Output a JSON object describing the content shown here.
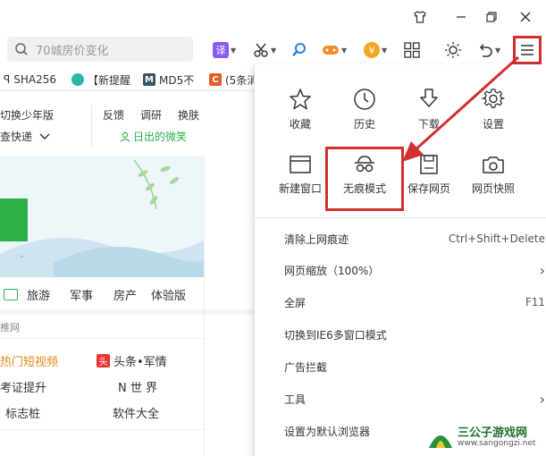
{
  "titlebar": {
    "icons": [
      "tshirt-icon",
      "minimize-icon",
      "restore-icon",
      "close-icon"
    ]
  },
  "search": {
    "placeholder": "70城房价变化"
  },
  "toolbar": {
    "translate_label": "译",
    "fund_label": "¥"
  },
  "bookmarks": [
    {
      "label": "SHA256",
      "color": "#333"
    },
    {
      "label": "【新提醒",
      "color": "#2aa"
    },
    {
      "label": "MD5不",
      "icon_text": "M",
      "color": "#356"
    },
    {
      "label": "(5条消",
      "icon_text": "C",
      "color": "#e55"
    }
  ],
  "page": {
    "row1": [
      "切换少年版",
      "反馈",
      "调研",
      "换肤"
    ],
    "row2_left": "查快递",
    "row2_right": "日出的微笑",
    "nav": [
      "旅游",
      "军事",
      "房产",
      "体验版"
    ],
    "section_label": "推网",
    "links": [
      {
        "left": "热门短视频",
        "right": "头条•军情",
        "right_icon": "头"
      },
      {
        "left": "考证提升",
        "right": "N 世 界"
      },
      {
        "left": "标志桩",
        "right": "软件大全"
      }
    ]
  },
  "menu": {
    "grid_row1": [
      {
        "label": "收藏",
        "icon": "star-icon"
      },
      {
        "label": "历史",
        "icon": "clock-icon"
      },
      {
        "label": "下载",
        "icon": "download-icon"
      },
      {
        "label": "设置",
        "icon": "gear-icon"
      }
    ],
    "grid_row2": [
      {
        "label": "新建窗口",
        "icon": "window-icon"
      },
      {
        "label": "无痕模式",
        "icon": "incognito-icon"
      },
      {
        "label": "保存网页",
        "icon": "save-icon"
      },
      {
        "label": "网页快照",
        "icon": "camera-icon"
      }
    ],
    "items": [
      {
        "label": "清除上网痕迹",
        "shortcut": "Ctrl+Shift+Delete"
      },
      {
        "label": "网页缩放（100%）",
        "shortcut": "›"
      },
      {
        "label": "全屏",
        "shortcut": "F11"
      },
      {
        "label": "切换到IE6多窗口模式",
        "shortcut": ""
      },
      {
        "label": "广告拦截",
        "shortcut": ""
      },
      {
        "label": "工具",
        "shortcut": "›"
      },
      {
        "label": "设置为默认浏览器",
        "shortcut": ""
      }
    ]
  },
  "watermark": {
    "title": "三公子游戏网",
    "url": "www.sangongzi.net"
  },
  "colors": {
    "accent_red": "#d32f2f",
    "green": "#2db24a"
  }
}
